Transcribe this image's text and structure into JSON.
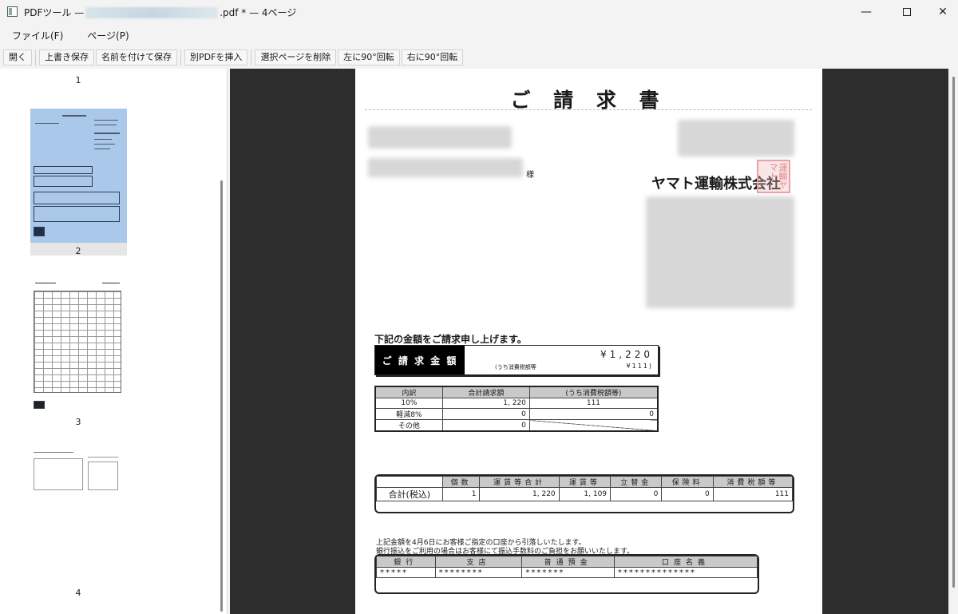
{
  "window": {
    "title_prefix": "PDFツール —",
    "title_suffix": ".pdf * — 4ページ",
    "minimize_glyph": "—",
    "close_glyph": "✕"
  },
  "menu": {
    "items": [
      "ファイル(F)",
      "ページ(P)"
    ]
  },
  "toolbar": {
    "open": "開く",
    "overwrite_save": "上書き保存",
    "save_as": "名前を付けて保存",
    "insert_pdf": "別PDFを挿入",
    "delete_pages": "選択ページを削除",
    "rotate_left": "左に90°回転",
    "rotate_right": "右に90°回転"
  },
  "thumbnails": {
    "page_numbers": [
      "1",
      "2",
      "3",
      "4"
    ],
    "selected_index": 1
  },
  "document": {
    "title": "ご 請 求 書",
    "honorific": "様",
    "company": "ヤマト運輸株式会社",
    "seal_text": "運輸ヤマト",
    "lead_text": "下記の金額をご請求申し上げます。",
    "amount_label": "ご 請 求 金 額",
    "amount_value": "¥1,220",
    "tax_label": "(うち消費税額等",
    "tax_value": "¥111)",
    "breakdown": {
      "headers": [
        "内訳",
        "合計請求額",
        "(うち消費税額等)"
      ],
      "rows": [
        [
          "10%",
          "1, 220",
          "111"
        ],
        [
          "軽減8%",
          "0",
          "0"
        ],
        [
          "その他",
          "0",
          ""
        ]
      ]
    },
    "summary": {
      "headers": [
        "個数",
        "運賃等合計",
        "運賃等",
        "立替金",
        "保険料",
        "消費税額等"
      ],
      "row_label": "合計(税込)",
      "values": [
        "1",
        "1, 220",
        "1, 109",
        "0",
        "0",
        "111"
      ]
    },
    "note_1": "上記金額を4月6日にお客様ご指定の口座から引落しいたします。",
    "note_2": "銀行振込をご利用の場合はお客様にて振込手数料のご負担をお願いいたします。",
    "bank": {
      "headers": [
        "銀行",
        "支店",
        "普通預金",
        "口座名義"
      ],
      "values": [
        "*****",
        "********",
        "*******",
        "**************"
      ]
    }
  }
}
